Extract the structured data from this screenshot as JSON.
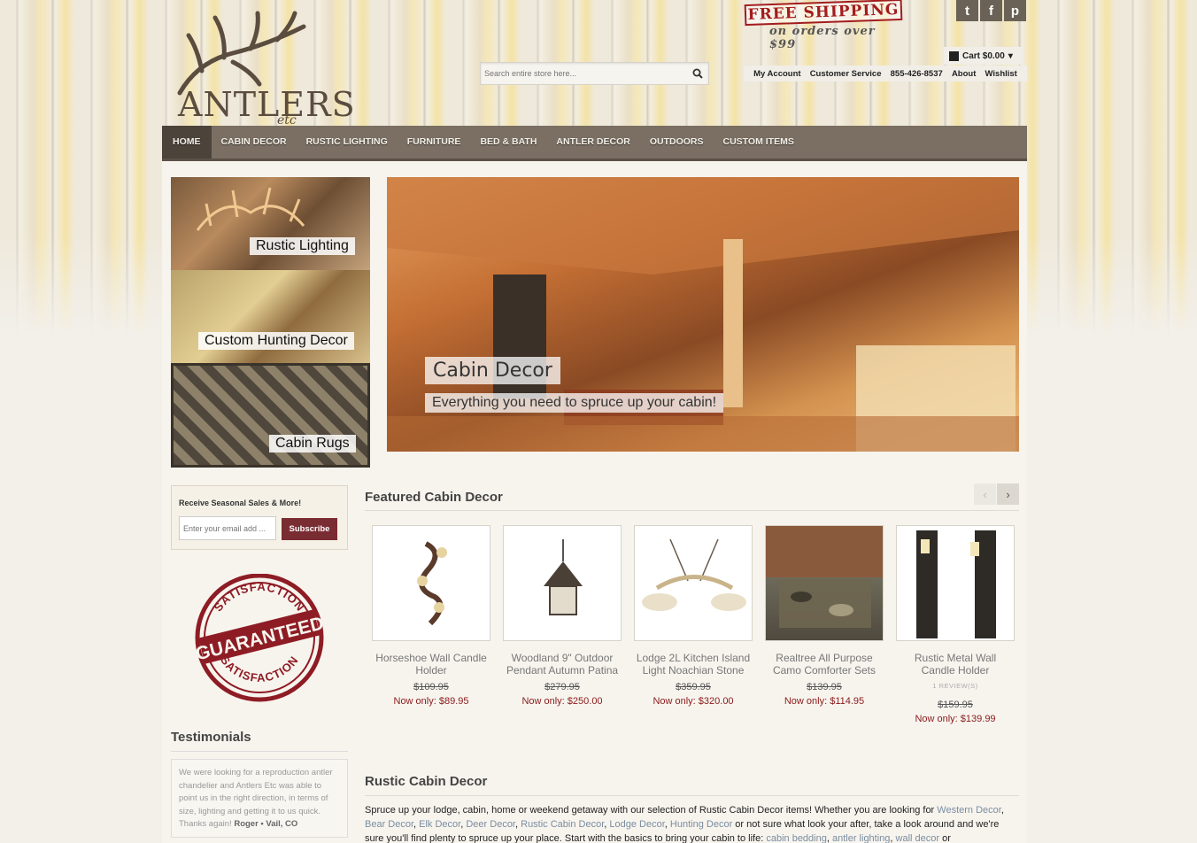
{
  "header": {
    "logo_name": "ANTLERS",
    "logo_sub": "etc",
    "free_shipping": "FREE SHIPPING",
    "free_shipping_sub": "on orders over $99",
    "search_placeholder": "Search entire store here...",
    "cart_label": "Cart $0.00",
    "links": [
      "My Account",
      "Customer Service",
      "855-426-8537",
      "About",
      "Wishlist"
    ],
    "social": [
      {
        "icon": "twitter-icon",
        "glyph": "t"
      },
      {
        "icon": "facebook-icon",
        "glyph": "f"
      },
      {
        "icon": "pinterest-icon",
        "glyph": "p"
      }
    ]
  },
  "nav": [
    "HOME",
    "CABIN DECOR",
    "RUSTIC LIGHTING",
    "FURNITURE",
    "BED & BATH",
    "ANTLER DECOR",
    "OUTDOORS",
    "CUSTOM ITEMS"
  ],
  "tiles": [
    "Rustic Lighting",
    "Custom Hunting Decor",
    "Cabin Rugs"
  ],
  "hero": {
    "title": "Cabin Decor",
    "subtitle": "Everything you need to spruce up your cabin!"
  },
  "newsletter": {
    "title": "Receive Seasonal Sales & More!",
    "placeholder": "Enter your email add ...",
    "button": "Subscribe"
  },
  "stamp": {
    "top": "SATISFACTION",
    "middle": "GUARANTEED",
    "bottom": "SATISFACTION"
  },
  "testimonials": {
    "heading": "Testimonials",
    "text": "We were looking for a reproduction antler chandelier and Antlers Etc was able to point us in the right direction, in terms of size, lighting and getting it to us quick. Thanks again!",
    "author": "Roger • Vail, CO"
  },
  "featured": {
    "heading": "Featured Cabin Decor",
    "products": [
      {
        "name": "Horseshoe Wall Candle Holder",
        "old": "$109.95",
        "now": "Now only: $89.95",
        "reviews": ""
      },
      {
        "name": "Woodland 9\" Outdoor Pendant Autumn Patina",
        "old": "$279.95",
        "now": "Now only: $250.00",
        "reviews": ""
      },
      {
        "name": "Lodge 2L Kitchen Island Light Noachian Stone",
        "old": "$359.95",
        "now": "Now only: $320.00",
        "reviews": ""
      },
      {
        "name": "Realtree All Purpose Camo Comforter Sets",
        "old": "$139.95",
        "now": "Now only: $114.95",
        "reviews": ""
      },
      {
        "name": "Rustic Metal Wall Candle Holder",
        "old": "$159.95",
        "now": "Now only: $139.99",
        "reviews": "1 REVIEW(S)"
      }
    ]
  },
  "rustic": {
    "heading": "Rustic Cabin Decor",
    "text_1": "Spruce up your lodge, cabin, home or weekend getaway with our selection of Rustic Cabin Decor items! Whether you are looking for ",
    "link_1": "Western Decor",
    "sep_1": ", ",
    "link_2": "Bear Decor",
    "sep_2": ", ",
    "link_3": "Elk Decor",
    "sep_3": ", ",
    "link_4": "Deer Decor",
    "sep_4": ", ",
    "link_5": "Rustic Cabin Decor",
    "sep_5": ", ",
    "link_6": "Lodge Decor",
    "sep_6": ", ",
    "link_7": "Hunting Decor",
    "text_2": " or not sure what look your after, take a look around and we're sure you'll find plenty to spruce up your place. Start with the basics to bring your cabin to life: ",
    "link_8": "cabin bedding",
    "sep_8": ", ",
    "link_9": "antler lighting",
    "sep_9": ", ",
    "link_10": "wall decor",
    "text_3": " or"
  }
}
